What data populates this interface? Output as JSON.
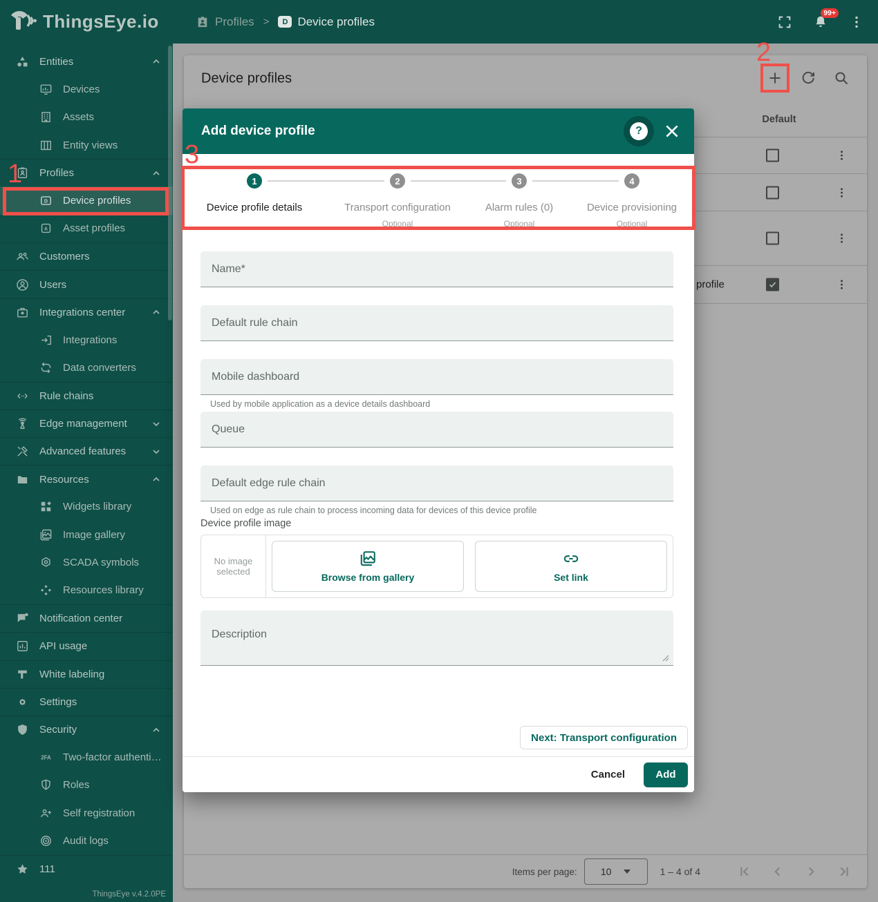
{
  "app": {
    "brand": "ThingsEye.io",
    "version": "ThingsEye v.4.2.0PE"
  },
  "header": {
    "breadcrumb": [
      "Profiles",
      "Device profiles"
    ],
    "breadcrumb_separator": ">",
    "notification_badge": "99+"
  },
  "sidebar": {
    "items": [
      {
        "label": "Entities",
        "icon": "entities-icon",
        "expanded": true
      },
      {
        "label": "Devices",
        "icon": "devices-icon",
        "child": true
      },
      {
        "label": "Assets",
        "icon": "assets-icon",
        "child": true
      },
      {
        "label": "Entity views",
        "icon": "entity-views-icon",
        "child": true
      },
      {
        "label": "Profiles",
        "icon": "profiles-icon",
        "expanded": true
      },
      {
        "label": "Device profiles",
        "icon": "device-profile-icon",
        "child": true,
        "selected": true
      },
      {
        "label": "Asset profiles",
        "icon": "asset-profile-icon",
        "child": true
      },
      {
        "label": "Customers",
        "icon": "customers-icon"
      },
      {
        "label": "Users",
        "icon": "users-icon"
      },
      {
        "label": "Integrations center",
        "icon": "integrations-center-icon",
        "expanded": true
      },
      {
        "label": "Integrations",
        "icon": "integrations-icon",
        "child": true
      },
      {
        "label": "Data converters",
        "icon": "data-converters-icon",
        "child": true
      },
      {
        "label": "Rule chains",
        "icon": "rule-chains-icon"
      },
      {
        "label": "Edge management",
        "icon": "edge-management-icon",
        "expanded": false
      },
      {
        "label": "Advanced features",
        "icon": "advanced-features-icon",
        "expanded": false
      },
      {
        "label": "Resources",
        "icon": "resources-icon",
        "expanded": true
      },
      {
        "label": "Widgets library",
        "icon": "widgets-library-icon",
        "child": true
      },
      {
        "label": "Image gallery",
        "icon": "image-gallery-icon",
        "child": true
      },
      {
        "label": "SCADA symbols",
        "icon": "scada-symbols-icon",
        "child": true
      },
      {
        "label": "Resources library",
        "icon": "resources-library-icon",
        "child": true
      },
      {
        "label": "Notification center",
        "icon": "notification-center-icon"
      },
      {
        "label": "API usage",
        "icon": "api-usage-icon"
      },
      {
        "label": "White labeling",
        "icon": "white-labeling-icon"
      },
      {
        "label": "Settings",
        "icon": "settings-icon"
      },
      {
        "label": "Security",
        "icon": "security-icon",
        "expanded": true
      },
      {
        "label": "Two-factor authenticati…",
        "icon": "two-factor-icon",
        "child": true
      },
      {
        "label": "Roles",
        "icon": "roles-icon",
        "child": true
      },
      {
        "label": "Self registration",
        "icon": "self-registration-icon",
        "child": true
      },
      {
        "label": "Audit logs",
        "icon": "audit-logs-icon",
        "child": true
      },
      {
        "label": "111",
        "icon": "star-icon"
      }
    ]
  },
  "main": {
    "title": "Device profiles",
    "table": {
      "default_column": "Default",
      "rows": [
        {
          "checked": false
        },
        {
          "checked": false
        },
        {
          "checked": false
        },
        {
          "checked": true,
          "name_fragment": "profile"
        }
      ]
    },
    "pagination": {
      "label": "Items per page:",
      "page_size": "10",
      "range": "1 – 4 of 4"
    }
  },
  "dialog": {
    "title": "Add device profile",
    "help_glyph": "?",
    "steps": [
      {
        "num": "1",
        "label": "Device profile details",
        "optional": "",
        "active": true
      },
      {
        "num": "2",
        "label": "Transport configuration",
        "optional": "Optional",
        "active": false
      },
      {
        "num": "3",
        "label": "Alarm rules (0)",
        "optional": "Optional",
        "active": false
      },
      {
        "num": "4",
        "label": "Device provisioning",
        "optional": "Optional",
        "active": false
      }
    ],
    "fields": [
      {
        "label": "Name*"
      },
      {
        "label": "Default rule chain"
      },
      {
        "label": "Mobile dashboard",
        "hint": "Used by mobile application as a device details dashboard"
      },
      {
        "label": "Queue"
      },
      {
        "label": "Default edge rule chain",
        "hint": "Used on edge as rule chain to process incoming data for devices of this device profile"
      }
    ],
    "image": {
      "label": "Device profile image",
      "empty": "No image selected",
      "browse": "Browse from gallery",
      "set_link": "Set link"
    },
    "description_label": "Description",
    "next_label": "Next: Transport configuration",
    "cancel_label": "Cancel",
    "add_label": "Add"
  },
  "annotations": {
    "n1": "1",
    "n2": "2",
    "n3": "3"
  },
  "colors": {
    "teal_dark": "#0e4f47",
    "accent": "#07695e",
    "annotation_red": "#f0504a",
    "badge_red": "#e53935",
    "selected_item": "#2a5f56"
  }
}
